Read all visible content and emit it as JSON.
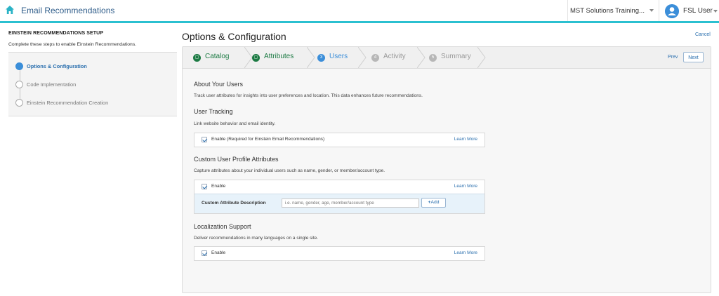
{
  "header": {
    "app_title": "Email Recommendations",
    "org_name": "MST Solutions Training...",
    "user_name": "FSL User"
  },
  "sidebar": {
    "title": "EINSTEIN RECOMMENDATIONS SETUP",
    "subtitle": "Complete these steps to enable Einstein Recommendations.",
    "steps": [
      {
        "label": "Options & Configuration",
        "active": true
      },
      {
        "label": "Code Implementation",
        "active": false
      },
      {
        "label": "Einstein Recommendation Creation",
        "active": false
      }
    ]
  },
  "main": {
    "title": "Options & Configuration",
    "cancel_label": "Cancel",
    "wizard": {
      "steps": [
        {
          "label": "Catalog",
          "state": "done"
        },
        {
          "label": "Attributes",
          "state": "done"
        },
        {
          "num": "3",
          "label": "Users",
          "state": "current"
        },
        {
          "num": "4",
          "label": "Activity",
          "state": "todo"
        },
        {
          "num": "5",
          "label": "Summary",
          "state": "todo"
        }
      ],
      "prev_label": "Prev",
      "next_label": "Next"
    },
    "about": {
      "heading": "About Your Users",
      "description": "Track user attributes for insights into user preferences and location. This data enhances future recommendations."
    },
    "tracking": {
      "heading": "User Tracking",
      "description": "Link website behavior and email identity.",
      "enable_label": "Enable (Required for Einstein Email Recommendations)",
      "learn_more": "Learn More"
    },
    "custom_attributes": {
      "heading": "Custom User Profile Attributes",
      "description": "Capture attributes about your individual users such as name, gender, or member/account type.",
      "enable_label": "Enable",
      "learn_more": "Learn More",
      "attr_label": "Custom Attribute Description",
      "attr_placeholder": "i.e. name, gender, age, member/account type",
      "add_label": "Add"
    },
    "localization": {
      "heading": "Localization Support",
      "description": "Deliver recommendations in many languages on a single site.",
      "enable_label": "Enable",
      "learn_more": "Learn More"
    }
  },
  "colors": {
    "accent": "#2bc0d0",
    "link": "#2a6fae",
    "done": "#1c7a43",
    "current": "#3b8ed9"
  }
}
